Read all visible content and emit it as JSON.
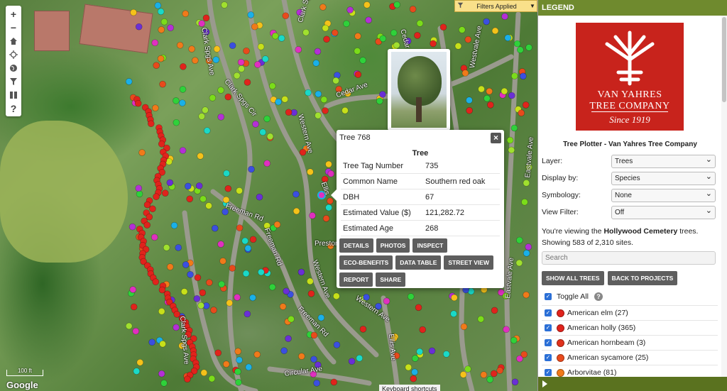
{
  "filters": {
    "label": "Filters Applied"
  },
  "toolbar": {
    "zoom_in": "+",
    "zoom_out": "−",
    "help": "?"
  },
  "roads": [
    {
      "name": "Clark Spgs Ave"
    },
    {
      "name": "Clark Spring Cir"
    },
    {
      "name": "Clark Spgs Cir"
    },
    {
      "name": "Cedar Ave"
    },
    {
      "name": "Western Ave"
    },
    {
      "name": "Ellis"
    },
    {
      "name": "Freeman Rd"
    },
    {
      "name": "Westvale Ave"
    },
    {
      "name": "Eastvale Ave"
    },
    {
      "name": "Preston"
    },
    {
      "name": "Circular Ave"
    },
    {
      "name": "Ellis Ave"
    },
    {
      "name": "Cedar"
    }
  ],
  "popup": {
    "title": "Tree 768",
    "header": "Tree",
    "rows": [
      {
        "label": "Tree Tag Number",
        "value": "735"
      },
      {
        "label": "Common Name",
        "value": "Southern red oak"
      },
      {
        "label": "DBH",
        "value": "67"
      },
      {
        "label": "Estimated Value ($)",
        "value": "121,282.72"
      },
      {
        "label": "Estimated Age",
        "value": "268"
      }
    ],
    "buttons": [
      "DETAILS",
      "PHOTOS",
      "INSPECT",
      "ECO-BENEFITS",
      "DATA TABLE",
      "STREET VIEW",
      "REPORT",
      "SHARE"
    ]
  },
  "map": {
    "scale": "100 ft",
    "attribution": "Google",
    "shortcuts": "Keyboard shortcuts"
  },
  "legend": {
    "header": "LEGEND",
    "logo": {
      "line1": "VAN YAHRES",
      "line2": "TREE COMPANY",
      "line3": "Since 1919"
    },
    "title": "Tree Plotter - Van Yahres Tree Company",
    "controls": [
      {
        "label": "Layer:",
        "value": "Trees"
      },
      {
        "label": "Display by:",
        "value": "Species"
      },
      {
        "label": "Symbology:",
        "value": "None"
      },
      {
        "label": "View Filter:",
        "value": "Off"
      }
    ],
    "viewing_prefix": "You're viewing the ",
    "viewing_name": "Hollywood Cemetery",
    "viewing_suffix": " trees.",
    "showing": "Showing 583 of 2,310 sites.",
    "search_placeholder": "Search",
    "buttons": {
      "show_all": "SHOW ALL TREES",
      "back": "BACK TO PROJECTS"
    },
    "toggle_all": "Toggle All",
    "species": [
      {
        "name": "American elm (27)",
        "color": "#e0231c"
      },
      {
        "name": "American holly (365)",
        "color": "#e0231c"
      },
      {
        "name": "American hornbeam (3)",
        "color": "#e0321c"
      },
      {
        "name": "American sycamore (25)",
        "color": "#e84a1c"
      },
      {
        "name": "Arborvitae (81)",
        "color": "#f07a1a"
      }
    ]
  },
  "colors": {
    "legend_header": "#6f8a2e",
    "brand_red": "#c8231c",
    "button_gray": "#5e5e5e",
    "filters_yellow": "#f9e08a"
  }
}
